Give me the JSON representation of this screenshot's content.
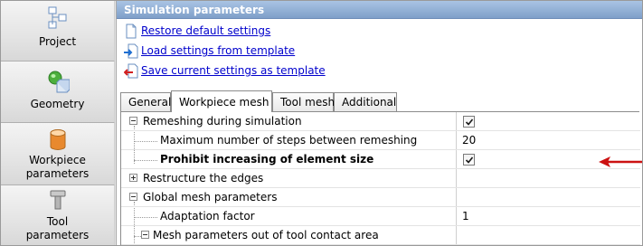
{
  "sidebar": {
    "items": [
      {
        "label_lines": [
          "Project"
        ],
        "icon": "project-icon"
      },
      {
        "label_lines": [
          "Geometry"
        ],
        "icon": "geometry-icon"
      },
      {
        "label_lines": [
          "Workpiece",
          "parameters"
        ],
        "icon": "workpiece-icon"
      },
      {
        "label_lines": [
          "Tool",
          "parameters"
        ],
        "icon": "tool-icon"
      }
    ]
  },
  "panel": {
    "title": "Simulation parameters",
    "actions": [
      {
        "label": "Restore default settings",
        "icon": "document-icon"
      },
      {
        "label": "Load settings from template",
        "icon": "load-arrow-icon"
      },
      {
        "label": "Save current settings as template",
        "icon": "save-arrow-icon"
      }
    ],
    "tabs": [
      "General",
      "Workpiece mesh",
      "Tool mesh",
      "Additional"
    ],
    "active_tab": "Workpiece mesh"
  },
  "grid": {
    "rows": [
      {
        "name": "Remeshing during simulation",
        "value": "",
        "checked": true,
        "bold": false
      },
      {
        "name": "Maximum number of steps between remeshing",
        "value": "20",
        "bold": false
      },
      {
        "name": "Prohibit increasing of element size",
        "value": "",
        "checked": true,
        "bold": true
      },
      {
        "name": "Restructure the edges",
        "value": "",
        "bold": false
      },
      {
        "name": "Global mesh parameters",
        "value": "",
        "bold": false
      },
      {
        "name": "Adaptation factor",
        "value": "1",
        "bold": false
      },
      {
        "name": "Mesh parameters out of tool contact area",
        "value": "",
        "bold": false
      }
    ]
  },
  "colors": {
    "accent_title": "#8fb0d8",
    "link": "#0000cc",
    "arrow": "#cc1111"
  }
}
